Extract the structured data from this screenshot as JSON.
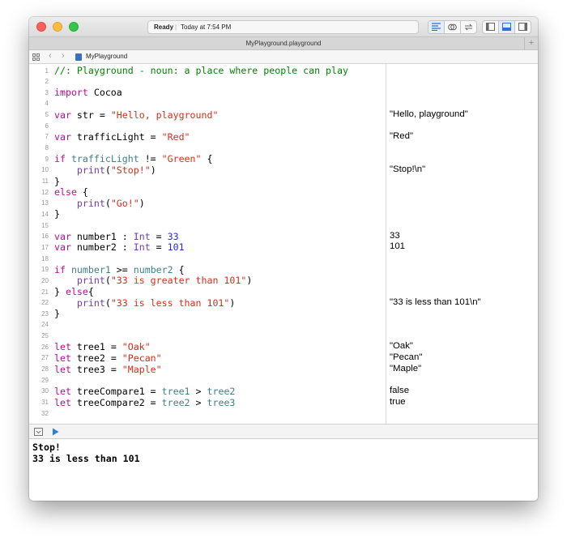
{
  "toolbar": {
    "status": "Ready",
    "status_separator": "|",
    "timestamp": "Today at 7:54 PM"
  },
  "tab": {
    "title": "MyPlayground.playground",
    "add_label": "+"
  },
  "jumpbar": {
    "breadcrumb": "MyPlayground",
    "back": "‹",
    "forward": "›"
  },
  "code_lines": [
    {
      "n": "1",
      "html": "<span class=\"cmt\">//: Playground - noun: a place where people can play</span>"
    },
    {
      "n": "2",
      "html": ""
    },
    {
      "n": "3",
      "html": "<span class=\"kw\">import</span> Cocoa"
    },
    {
      "n": "4",
      "html": ""
    },
    {
      "n": "5",
      "html": "<span class=\"kw\">var</span> str = <span class=\"str\">\"Hello, playground\"</span>"
    },
    {
      "n": "6",
      "html": ""
    },
    {
      "n": "7",
      "html": "<span class=\"kw\">var</span> trafficLight = <span class=\"str\">\"Red\"</span>"
    },
    {
      "n": "8",
      "html": ""
    },
    {
      "n": "9",
      "html": "<span class=\"kw\">if</span> <span class=\"var\">trafficLight</span> != <span class=\"str\">\"Green\"</span> {"
    },
    {
      "n": "10",
      "html": "    <span class=\"type\">print</span>(<span class=\"str\">\"Stop!\"</span>)"
    },
    {
      "n": "11",
      "html": "}"
    },
    {
      "n": "12",
      "html": "<span class=\"kw\">else</span> {"
    },
    {
      "n": "13",
      "html": "    <span class=\"type\">print</span>(<span class=\"str\">\"Go!\"</span>)"
    },
    {
      "n": "14",
      "html": "}"
    },
    {
      "n": "15",
      "html": ""
    },
    {
      "n": "16",
      "html": "<span class=\"kw\">var</span> number1 : <span class=\"type\">Int</span> = <span class=\"num\">33</span>"
    },
    {
      "n": "17",
      "html": "<span class=\"kw\">var</span> number2 : <span class=\"type\">Int</span> = <span class=\"num\">101</span>"
    },
    {
      "n": "18",
      "html": ""
    },
    {
      "n": "19",
      "html": "<span class=\"kw\">if</span> <span class=\"var\">number1</span> &gt;= <span class=\"var\">number2</span> {"
    },
    {
      "n": "20",
      "html": "    <span class=\"type\">print</span>(<span class=\"str\">\"33 is greater than 101\"</span>)"
    },
    {
      "n": "21",
      "html": "} <span class=\"kw\">else</span>{"
    },
    {
      "n": "22",
      "html": "    <span class=\"type\">print</span>(<span class=\"str\">\"33 is less than 101\"</span>)"
    },
    {
      "n": "23",
      "html": "}"
    },
    {
      "n": "24",
      "html": ""
    },
    {
      "n": "25",
      "html": ""
    },
    {
      "n": "26",
      "html": "<span class=\"kw\">let</span> tree1 = <span class=\"str\">\"Oak\"</span>"
    },
    {
      "n": "27",
      "html": "<span class=\"kw\">let</span> tree2 = <span class=\"str\">\"Pecan\"</span>"
    },
    {
      "n": "28",
      "html": "<span class=\"kw\">let</span> tree3 = <span class=\"str\">\"Maple\"</span>"
    },
    {
      "n": "29",
      "html": ""
    },
    {
      "n": "30",
      "html": "<span class=\"kw\">let</span> treeCompare1 = <span class=\"var\">tree1</span> &gt; <span class=\"var\">tree2</span>"
    },
    {
      "n": "31",
      "html": "<span class=\"kw\">let</span> treeCompare2 = <span class=\"var\">tree2</span> &gt; <span class=\"var\">tree3</span>"
    },
    {
      "n": "32",
      "html": ""
    }
  ],
  "results": [
    {
      "line": 5,
      "text": "\"Hello, playground\""
    },
    {
      "line": 7,
      "text": "\"Red\""
    },
    {
      "line": 10,
      "text": "\"Stop!\\n\""
    },
    {
      "line": 16,
      "text": "33"
    },
    {
      "line": 17,
      "text": "101"
    },
    {
      "line": 22,
      "text": "\"33 is less than 101\\n\""
    },
    {
      "line": 26,
      "text": "\"Oak\""
    },
    {
      "line": 27,
      "text": "\"Pecan\""
    },
    {
      "line": 28,
      "text": "\"Maple\""
    },
    {
      "line": 30,
      "text": "false"
    },
    {
      "line": 31,
      "text": "true"
    }
  ],
  "console": [
    "Stop!",
    "33 is less than 101"
  ],
  "colors": {
    "keyword": "#bb0c8f",
    "string": "#d12f1b",
    "number": "#272ad8",
    "type": "#703daa",
    "variable": "#3e8087",
    "comment": "#008400"
  }
}
